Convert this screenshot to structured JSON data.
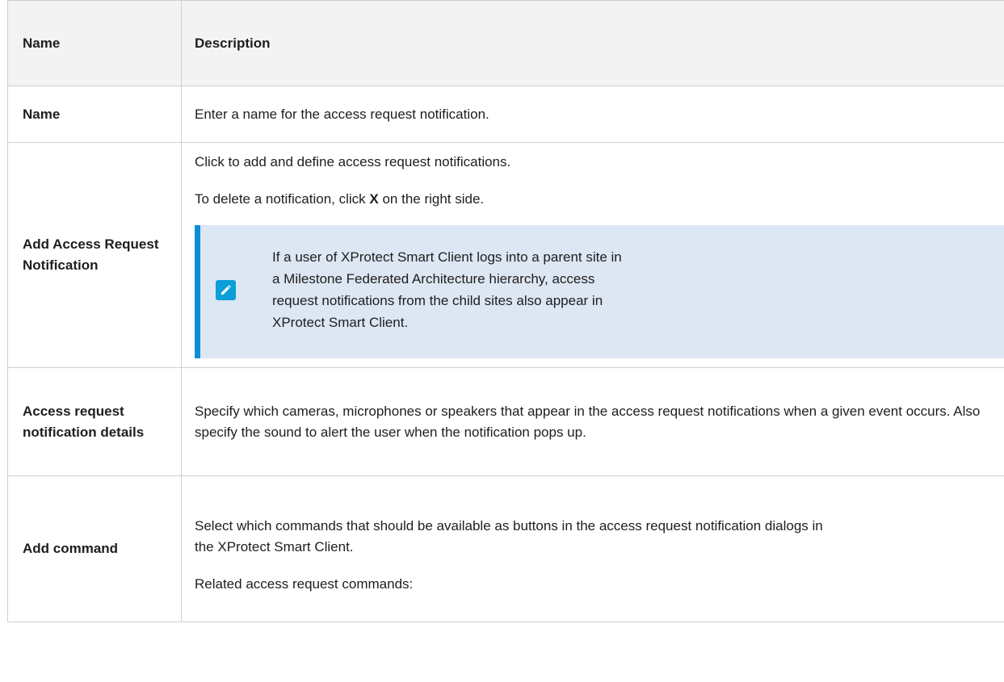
{
  "table": {
    "header": {
      "name": "Name",
      "description": "Description"
    },
    "rows": [
      {
        "name": "Name",
        "description": "Enter a name for the access request notification."
      },
      {
        "name": "Add Access Request Notification",
        "para1": "Click to add and define access request notifications.",
        "para2_pre": "To delete a notification, click ",
        "para2_bold": "X",
        "para2_post": " on the right side.",
        "note": "If a user of XProtect Smart Client logs into a parent site in a Milestone Federated Architecture hierarchy, access request notifications from the child sites also appear in XProtect Smart Client.",
        "note_icon": "pencil-note-icon"
      },
      {
        "name": "Access request notification details",
        "description": "Specify which cameras, microphones or speakers that appear in the access request notifications when a given event occurs. Also specify the sound to alert the user when the notification pops up."
      },
      {
        "name": "Add command",
        "para1": "Select which commands that should be available as buttons in the access request notification dialogs in the XProtect Smart Client.",
        "para2": "Related access request commands:"
      }
    ]
  },
  "colors": {
    "accent": "#0a8fd8",
    "note_bg": "#dde6f3",
    "header_bg": "#f3f3f3",
    "border": "#cfcfcf"
  }
}
